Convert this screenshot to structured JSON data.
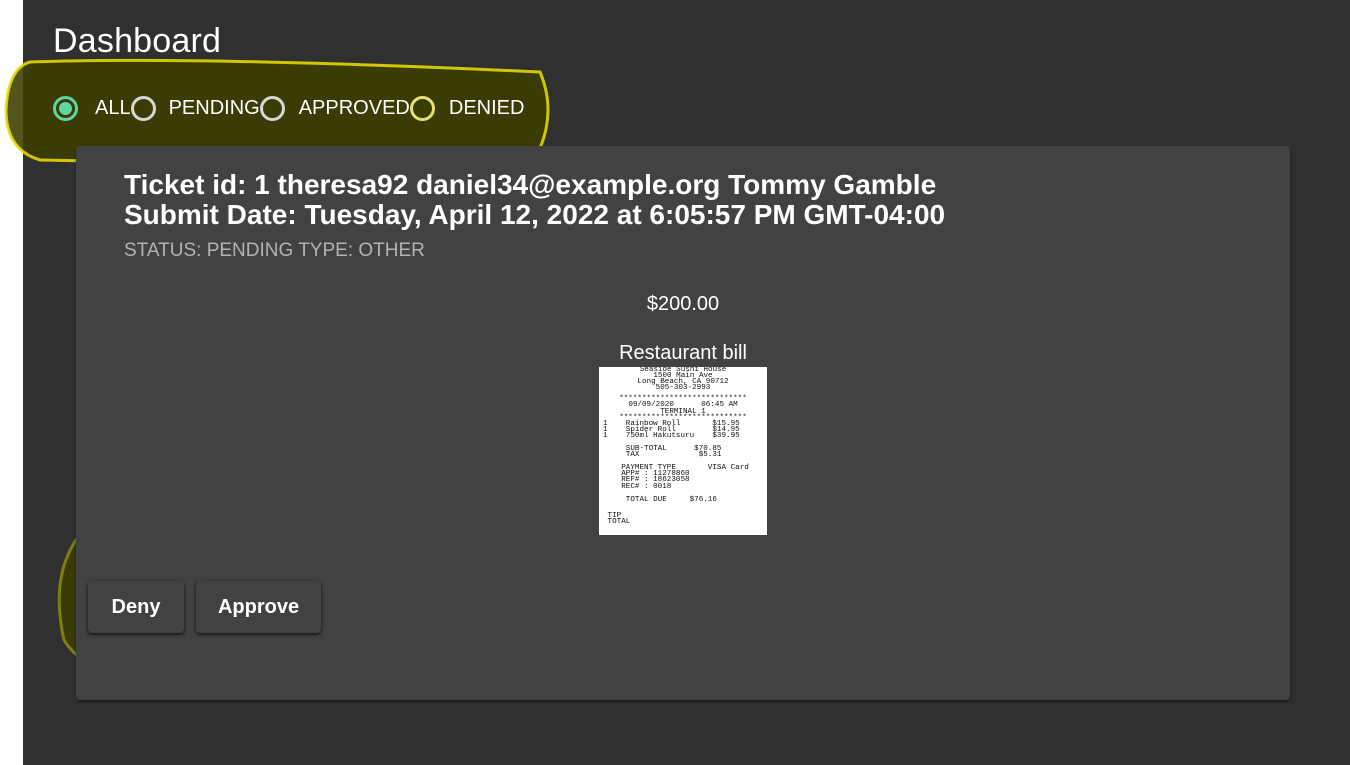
{
  "page": {
    "title": "Dashboard"
  },
  "filters": {
    "options": [
      {
        "label": "ALL",
        "checked": true
      },
      {
        "label": "PENDING",
        "checked": false
      },
      {
        "label": "APPROVED",
        "checked": false
      },
      {
        "label": "DENIED",
        "checked": false
      }
    ]
  },
  "ticket": {
    "line1": "Ticket id: 1 theresa92 daniel34@example.org Tommy Gamble",
    "line2": "Submit Date: Tuesday, April 12, 2022 at 6:05:57 PM GMT-04:00",
    "status_line": "STATUS: PENDING TYPE: OTHER",
    "amount": "$200.00",
    "description": "Restaurant bill",
    "receipt": {
      "header": [
        "Seaside Sushi House",
        "1500 Main Ave",
        "Long Beach, CA 90712",
        "505-303-2993"
      ],
      "separator": "****************************",
      "date_line": "09/09/2020      06:45 AM",
      "terminal": "TERMINAL 1",
      "items": [
        "1    Rainbow Roll       $15.95",
        "1    Spider Roll        $14.95",
        "1    750ml Hakutsuru    $39.95"
      ],
      "subtotal": "     SUB-TOTAL      $70.85",
      "tax": "     TAX             $5.31",
      "payment_type": "    PAYMENT TYPE       VISA Card",
      "app": "    APP# : 11278860",
      "ref": "    REF# : 18623058",
      "rec": "    REC# : 0018",
      "total_due": "     TOTAL DUE     $76.16",
      "tip": " TIP",
      "total": " TOTAL"
    },
    "actions": {
      "deny": "Deny",
      "approve": "Approve"
    }
  },
  "colors": {
    "background": "#303030",
    "card": "#424242",
    "radio_checked": "#5fd6a6",
    "highlight": "#4a4a00"
  }
}
